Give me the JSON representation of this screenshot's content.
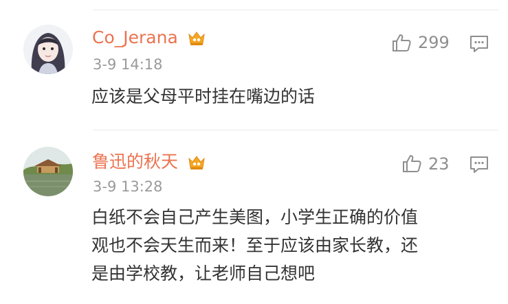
{
  "comments": [
    {
      "user": "Co_Jerana",
      "time": "3-9 14:18",
      "likes": "299",
      "text_lines": [
        "应该是父母平时挂在嘴边的话"
      ],
      "badge_icon": "vip-crown-icon",
      "avatar": "girl-portrait-avatar"
    },
    {
      "user": "鲁迅的秋天",
      "time": "3-9 13:28",
      "likes": "23",
      "text_lines": [
        "白纸不会自己产生美图，小学生正确的价值",
        "观也不会天生而来！至于应该由家长教，还",
        "是由学校教，让老师自己想吧"
      ],
      "badge_icon": "vip-crown-icon",
      "avatar": "pavilion-lake-avatar"
    }
  ],
  "colors": {
    "username": "#eb7350",
    "timestamp": "#9a9a9a",
    "body_text": "#333333",
    "icon_gray": "#8e8e8e",
    "badge_gold": "#f5a623",
    "divider": "#e9e9e9"
  }
}
